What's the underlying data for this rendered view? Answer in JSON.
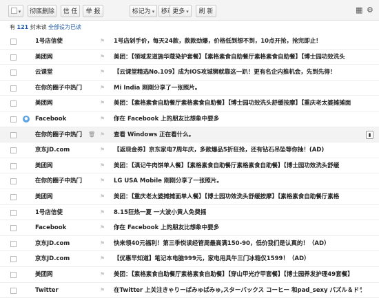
{
  "toolbar": {
    "delete_label": "彻底删除",
    "reject_label": "信 任",
    "report_label": "举 报",
    "mark_label": "标记为",
    "move_label": "移动到",
    "more_label": "更多",
    "refresh_label": "刷 新",
    "calendar_icon": "calendar-icon",
    "settings_icon": "gear-icon"
  },
  "subbar": {
    "count_prefix": "有",
    "count_value": "121",
    "count_suffix": "封未读",
    "mark_all": "全部设为已读"
  },
  "emails": [
    {
      "sender": "1号店信使",
      "subject": "1号店剁手价，每天24款，款款劲爆，价格低到想不到，10点开抢，抢完即止！",
      "avatar": false,
      "highlight": false,
      "trash": false,
      "tag": false
    },
    {
      "sender": "美团网",
      "subject": "美团：【领域发道施华蔻染护套餐】【素格素食自助餐厅素格素食自助餐】【博士园功效洗头",
      "avatar": false,
      "highlight": false,
      "trash": false,
      "tag": false
    },
    {
      "sender": "云课堂",
      "subject": "【云课堂精选No.109】成为iOS攻城狮就靠这一趴！更有名企内推机会，先到先得！",
      "avatar": false,
      "highlight": false,
      "trash": false,
      "tag": false
    },
    {
      "sender": "在你的圈子中热门",
      "subject": "Mi India 刚刚分享了一张照片。",
      "avatar": false,
      "highlight": false,
      "trash": false,
      "tag": false
    },
    {
      "sender": "美团网",
      "subject": "美团：【素格素食自助餐厅素格素食自助餐】【博士园功效洗头舒缓按摩】【重庆老太婆摊摊面",
      "avatar": false,
      "highlight": false,
      "trash": false,
      "tag": false
    },
    {
      "sender": "Facebook",
      "subject": "你在 Facebook 上的朋友比想象中要多",
      "avatar": true,
      "highlight": false,
      "trash": false,
      "tag": false
    },
    {
      "sender": "在你的圈子中热门",
      "subject": "查看 Windows 正在看什么。",
      "avatar": false,
      "highlight": true,
      "trash": true,
      "tag": true
    },
    {
      "sender": "京东JD.com",
      "subject": "【返现金券】京东家电7周年庆，多款爆品5折狂抢，还有钻石吊坠等你抽！(AD)",
      "avatar": false,
      "highlight": false,
      "trash": false,
      "tag": false
    },
    {
      "sender": "美团网",
      "subject": "美团：【滇记牛肉饼单人餐】【素格素食自助餐厅素格素食自助餐】【博士园功效洗头舒缓",
      "avatar": false,
      "highlight": false,
      "trash": false,
      "tag": false
    },
    {
      "sender": "在你的圈子中热门",
      "subject": "LG USA Mobile 刚刚分享了一张照片。",
      "avatar": false,
      "highlight": false,
      "trash": false,
      "tag": false
    },
    {
      "sender": "美团网",
      "subject": "美团：【重庆老太婆摊摊面单人餐】【博士园功效洗头舒缓按摩】【素格素食自助餐厅素格",
      "avatar": false,
      "highlight": false,
      "trash": false,
      "tag": false
    },
    {
      "sender": "1号店信使",
      "subject": "8.15狂热一夏 一大波小黄人免费摇",
      "avatar": false,
      "highlight": false,
      "trash": false,
      "tag": false
    },
    {
      "sender": "Facebook",
      "subject": "你在 Facebook 上的朋友比想象中要多",
      "avatar": false,
      "highlight": false,
      "trash": false,
      "tag": false
    },
    {
      "sender": "京东JD.com",
      "subject": "快来领40元福利！第三季悦读经管周最高满150-90，低价我们是认真的！（AD）",
      "avatar": false,
      "highlight": false,
      "trash": false,
      "tag": false
    },
    {
      "sender": "京东JD.com",
      "subject": "【优惠早知道】笔记本电脑999元，家电用具午三门冰箱仅1599！（AD）",
      "avatar": false,
      "highlight": false,
      "trash": false,
      "tag": false
    },
    {
      "sender": "美团网",
      "subject": "美团：【素格素食自助餐厅素格素食自助餐】【穿山甲光疗甲套餐】【博士园养发护理49套餐】",
      "avatar": false,
      "highlight": false,
      "trash": false,
      "tag": false
    },
    {
      "sender": "Twitter",
      "subject": "在Twitter 上关注きゃりーぱみゅぱみゅ,スターバックス コーヒー 和pad_sexy パズル＆ドラ…",
      "avatar": false,
      "highlight": false,
      "trash": false,
      "tag": false
    }
  ]
}
